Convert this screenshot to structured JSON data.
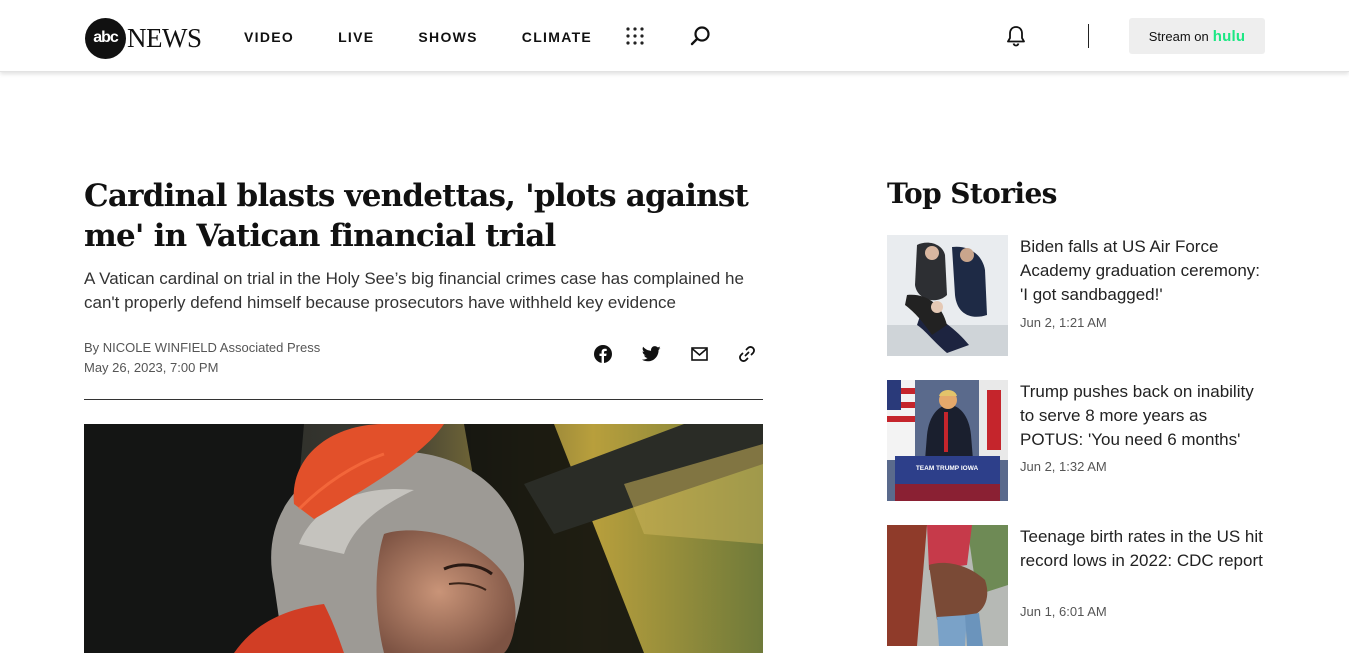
{
  "header": {
    "logo_mark": "abc",
    "logo_word": "NEWS",
    "nav": [
      "VIDEO",
      "LIVE",
      "SHOWS",
      "CLIMATE"
    ],
    "stream_label": "Stream on",
    "stream_brand": "hulu"
  },
  "article": {
    "headline": "Cardinal blasts vendettas, 'plots against me' in Vatican financial trial",
    "dek": "A Vatican cardinal on trial in the Holy See’s big financial crimes case has complained he can't properly defend himself because prosecutors have withheld key evidence",
    "byline": "By NICOLE WINFIELD Associated Press",
    "date": "May 26, 2023, 7:00 PM",
    "share_icons": [
      "facebook-icon",
      "twitter-icon",
      "email-icon",
      "link-icon"
    ]
  },
  "top_stories": {
    "title": "Top Stories",
    "items": [
      {
        "title": "Biden falls at US Air Force Academy graduation ceremony: 'I got sandbagged!'",
        "time": "Jun 2, 1:21 AM"
      },
      {
        "title": "Trump pushes back on inability to serve 8 more years as POTUS: 'You need 6 months'",
        "time": "Jun 2, 1:32 AM",
        "sign_text": "TEAM TRUMP IOWA"
      },
      {
        "title": "Teenage birth rates in the US hit record lows in 2022: CDC report",
        "time": "Jun 1, 6:01 AM"
      }
    ]
  },
  "colors": {
    "hulu": "#1ce783",
    "cardinal_red": "#e2502a",
    "text": "#111111"
  }
}
